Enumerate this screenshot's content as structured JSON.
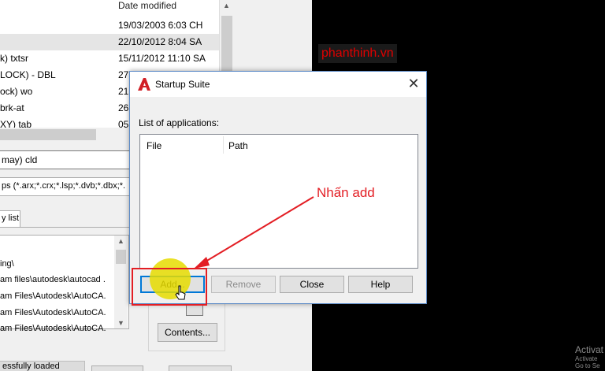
{
  "background_window": {
    "list": {
      "header_date": "Date modified",
      "rows": [
        {
          "name": "",
          "date": "19/03/2003 6:03 CH",
          "selected": false
        },
        {
          "name": "",
          "date": "22/10/2012 8:04 SA",
          "selected": true
        },
        {
          "name": "k) txtsr",
          "date": "15/11/2012 11:10 SA",
          "selected": false
        },
        {
          "name": "LOCK) - DBL",
          "date": "27",
          "selected": false
        },
        {
          "name": "ock) wo",
          "date": "21",
          "selected": false
        },
        {
          "name": "brk-at",
          "date": "26",
          "selected": false
        },
        {
          "name": "XY) tab",
          "date": "05",
          "selected": false
        }
      ]
    },
    "file_name": "may) cld",
    "file_type": "ps (*.arx;*.crx;*.lsp;*.dvb;*.dbx;*.",
    "tab_label": "y list",
    "loaded_apps": [
      "ing\\",
      "am files\\autodesk\\autocad .",
      "am Files\\Autodesk\\AutoCA.",
      "am Files\\Autodesk\\AutoCA.",
      "am Files\\Autodesk\\AutoCA."
    ],
    "contents_label": "Contents...",
    "status_text": "essfully loaded"
  },
  "watermark": "phanthinh.vn",
  "activate": {
    "line1": "Activat",
    "line2": "Activate",
    "line3": "Go to Se"
  },
  "dialog": {
    "title": "Startup Suite",
    "close_symbol": "✕",
    "list_label": "List of applications:",
    "columns": {
      "file": "File",
      "path": "Path"
    },
    "buttons": {
      "add": "Add...",
      "remove": "Remove",
      "close": "Close",
      "help": "Help"
    }
  },
  "annotation": {
    "text": "Nhấn add",
    "color": "#e31e24"
  }
}
